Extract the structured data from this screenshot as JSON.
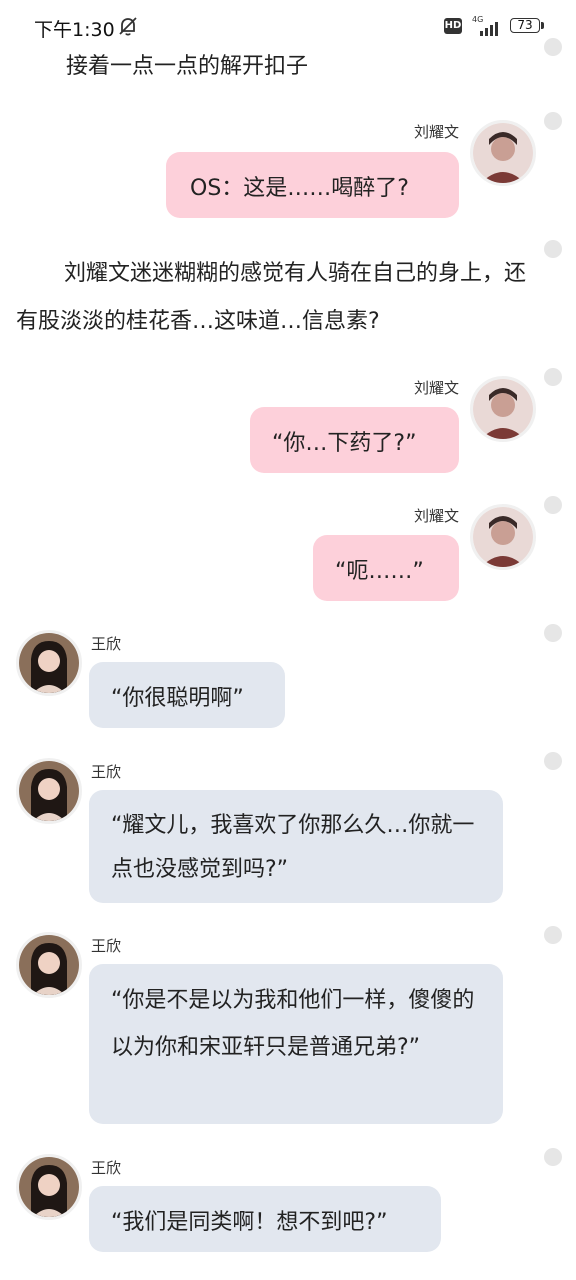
{
  "status_bar": {
    "time": "下午1:30",
    "hd": "HD",
    "network": "4G",
    "battery": "73"
  },
  "messages": [
    {
      "type": "narration",
      "text": "接着一点一点的解开扣子"
    },
    {
      "type": "chat",
      "side": "right",
      "sender": "刘耀文",
      "text": "OS：这是……喝醉了?"
    },
    {
      "type": "narration",
      "text": "刘耀文迷迷糊糊的感觉有人骑在自己的身上，还有股淡淡的桂花香…这味道…信息素?"
    },
    {
      "type": "chat",
      "side": "right",
      "sender": "刘耀文",
      "text": "“你…下药了?”"
    },
    {
      "type": "chat",
      "side": "right",
      "sender": "刘耀文",
      "text": "“呃……”"
    },
    {
      "type": "chat",
      "side": "left",
      "sender": "王欣",
      "text": "“你很聪明啊”"
    },
    {
      "type": "chat",
      "side": "left",
      "sender": "王欣",
      "text": "“耀文儿，我喜欢了你那么久…你就一点也没感觉到吗?”"
    },
    {
      "type": "chat",
      "side": "left",
      "sender": "王欣",
      "text": "“你是不是以为我和他们一样，傻傻的以为你和宋亚轩只是普通兄弟?”"
    },
    {
      "type": "chat",
      "side": "left",
      "sender": "王欣",
      "text": "“我们是同类啊！想不到吧?”"
    }
  ],
  "colors": {
    "right_bubble": "#fdd0da",
    "left_bubble": "#e2e7ef",
    "dot": "#e6e6e6"
  },
  "icons": {
    "status": [
      "mute-bell-icon",
      "hd-icon",
      "signal-4g-icon",
      "battery-icon"
    ]
  }
}
